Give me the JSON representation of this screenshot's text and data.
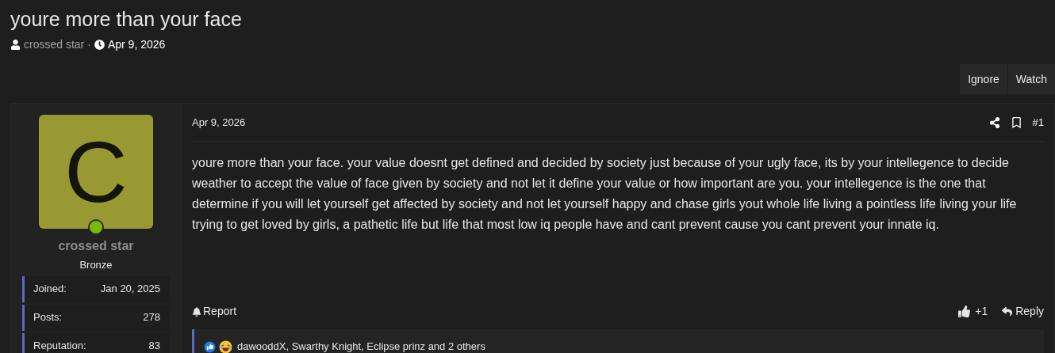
{
  "thread": {
    "title": "youre more than your face",
    "author": "crossed star",
    "separator": "·",
    "date": "Apr 9, 2026"
  },
  "thread_buttons": [
    "Ignore",
    "Watch"
  ],
  "user": {
    "avatar_letter": "C",
    "online": true,
    "name": "crossed star",
    "rank": "Bronze",
    "stats": [
      {
        "label": "Joined:",
        "value": "Jan 20, 2025"
      },
      {
        "label": "Posts:",
        "value": "278"
      },
      {
        "label": "Reputation:",
        "value": "83"
      }
    ]
  },
  "post": {
    "date": "Apr 9, 2026",
    "number": "#1",
    "body": "youre more than your face. your value doesnt get defined and decided by society just because of your ugly face, its by your intellegence to decide weather to accept the value of face given by society and not let it define your value or how important are you. your intellegence is the one that determine if you will let yourself get affected by society and not let yourself happy and chase girls yout whole life living a pointless life living your life trying to get loved by girls, a pathetic life but life that most low iq people have and cant prevent cause you cant prevent your innate iq.",
    "report": "Report",
    "like_count": "+1",
    "reply": "Reply",
    "reactions": "dawooddX, Swarthy Knight, Eclipse prinz and 2 others"
  }
}
